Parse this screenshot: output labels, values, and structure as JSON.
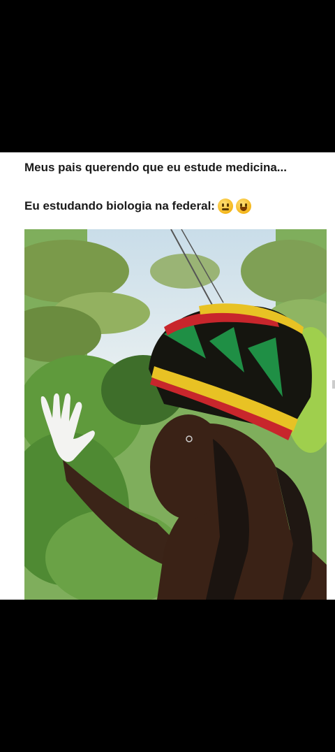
{
  "post": {
    "caption_line1": "Meus pais querendo que eu estude medicina...",
    "caption_line2": "Eu estudando biologia na federal:",
    "emojis": [
      "face-with-raised-eyebrow-icon",
      "grinning-squinting-face-icon"
    ]
  },
  "colors": {
    "background": "#000000",
    "card": "#ffffff",
    "text": "#1a1a1a",
    "hat_red": "#c8262c",
    "hat_yellow": "#e8c224",
    "hat_green": "#1f8f45"
  }
}
